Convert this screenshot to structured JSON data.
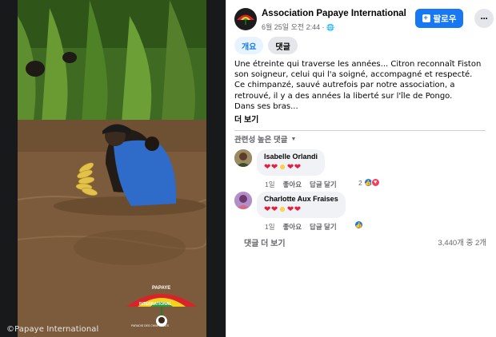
{
  "media": {
    "watermark": "©Papaye International",
    "logo_text_top": "PAPAYE",
    "logo_text_mid": "INTERNATIONAL",
    "logo_text_bottom": "PARADIS DES CHIMPANZES",
    "colors": {
      "water": "#7a5a3a",
      "grass": "#4f7f2a",
      "shirt": "#2f6bc8"
    }
  },
  "header": {
    "page_name": "Association Papaye International",
    "post_date": "6월 25일 오전 2:44 · ",
    "privacy_icon": "globe-icon",
    "follow_label": "팔로우",
    "more_label": "···"
  },
  "tabs": {
    "overview": "개요",
    "comments": "댓글"
  },
  "post": {
    "text_line1": "Une étreinte qui traverse les années... Citron reconnaît Fiston son soigneur, celui qui l'a soigné, accompagné et respecté.",
    "text_line2": "Ce chimpanzé, sauvé autrefois par notre association, a retrouvé, il y a des années la liberté sur l'île de Pongo.",
    "text_line3": "Dans ses bras...",
    "see_more": "더 보기"
  },
  "comments_section": {
    "sort_label": "관련성 높은 댓글",
    "comments": [
      {
        "name": "Isabelle Orlandi",
        "age": "1일",
        "like": "좋아요",
        "reply": "답글 달기",
        "reaction_count": "2"
      },
      {
        "name": "Charlotte Aux Fraises",
        "age": "1일",
        "like": "좋아요",
        "reply": "답글 달기",
        "reaction_count": ""
      }
    ],
    "more_comments": "댓글 더 보기",
    "count_text": "3,440개 중 2개"
  },
  "colors": {
    "accent": "#1877f2",
    "heart": "#e41e3f"
  }
}
